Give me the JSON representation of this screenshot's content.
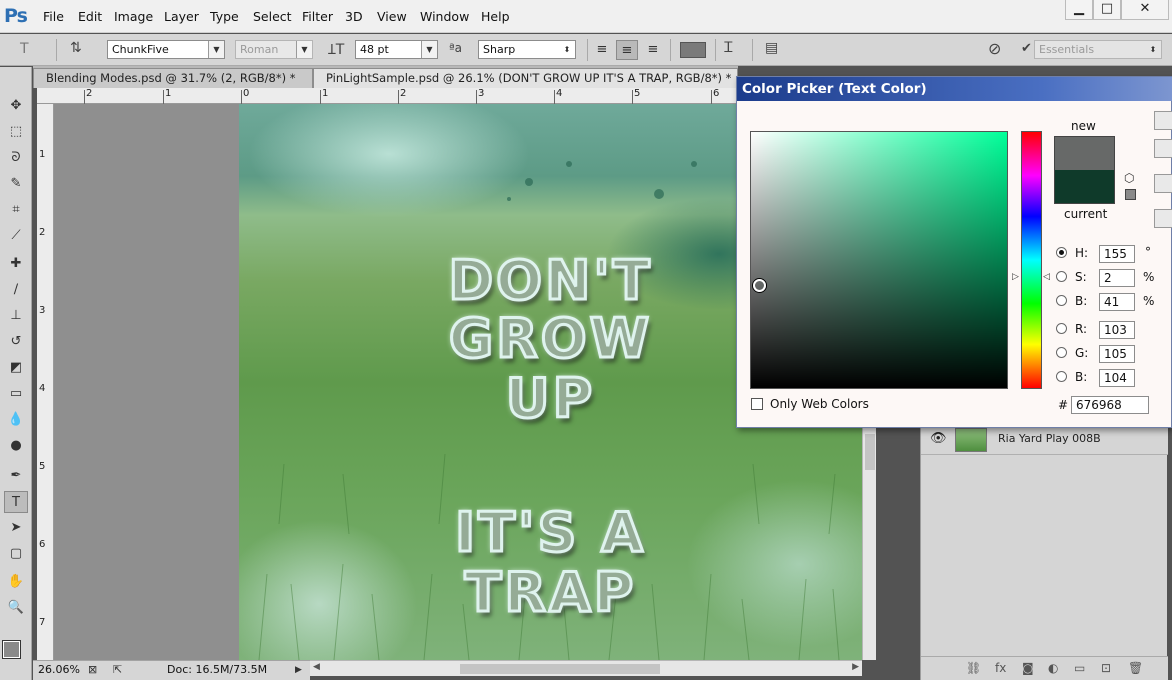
{
  "app": {
    "logo": "Ps"
  },
  "menu": [
    "File",
    "Edit",
    "Image",
    "Layer",
    "Type",
    "Select",
    "Filter",
    "3D",
    "View",
    "Window",
    "Help"
  ],
  "window_controls": {
    "minimize": "▁",
    "maximize": "□",
    "close": "✕"
  },
  "options": {
    "font_family": "ChunkFive",
    "font_style": "Roman",
    "font_size": "48 pt",
    "aa_label": "ªa",
    "antialias": "Sharp",
    "workspace": "Essentials"
  },
  "tabs": [
    {
      "label": "Blending Modes.psd @ 31.7% (2, RGB/8*) *",
      "active": false
    },
    {
      "label": "PinLightSample.psd @ 26.1% (DON'T  GROW UP  IT'S A TRAP, RGB/8*) *",
      "active": true
    }
  ],
  "ruler": {
    "h_labels": [
      "2",
      "1",
      "0",
      "1",
      "2",
      "3",
      "4",
      "5",
      "6"
    ],
    "v_labels": [
      "1",
      "2",
      "3",
      "4",
      "5",
      "6",
      "7"
    ]
  },
  "artwork": {
    "lines": [
      "DON'T",
      "GROW",
      "UP",
      "IT'S A",
      "TRAP"
    ]
  },
  "status": {
    "zoom": "26.06%",
    "doc": "Doc: 16.5M/73.5M"
  },
  "color_picker": {
    "title": "Color Picker (Text Color)",
    "new_label": "new",
    "current_label": "current",
    "new_color": "#676968",
    "current_color": "#0f3a2a",
    "hsb": [
      {
        "label": "H:",
        "value": "155",
        "unit": "°"
      },
      {
        "label": "S:",
        "value": "2",
        "unit": "%"
      },
      {
        "label": "B:",
        "value": "41",
        "unit": "%"
      }
    ],
    "rgb": [
      {
        "label": "R:",
        "value": "103"
      },
      {
        "label": "G:",
        "value": "105"
      },
      {
        "label": "B:",
        "value": "104"
      }
    ],
    "web_colors_label": "Only Web Colors",
    "hex_label": "#",
    "hex": "676968"
  },
  "layers": {
    "layer_name": "Ria Yard Play 008B"
  }
}
